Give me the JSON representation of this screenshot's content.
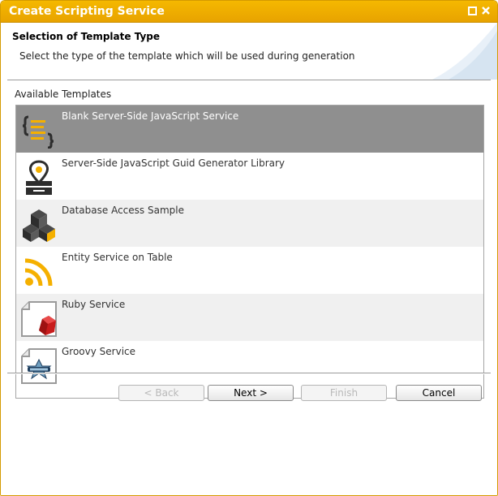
{
  "window": {
    "title": "Create Scripting Service"
  },
  "header": {
    "title": "Selection of Template Type",
    "description": "Select the type of the template which will be used during generation"
  },
  "templates": {
    "label": "Available Templates",
    "items": [
      {
        "label": "Blank Server-Side JavaScript Service",
        "icon": "javascript-code-icon",
        "selected": true
      },
      {
        "label": "Server-Side JavaScript Guid Generator Library",
        "icon": "guid-generator-icon",
        "selected": false
      },
      {
        "label": "Database Access Sample",
        "icon": "database-cubes-icon",
        "selected": false
      },
      {
        "label": "Entity Service on Table",
        "icon": "rss-feed-icon",
        "selected": false
      },
      {
        "label": "Ruby Service",
        "icon": "ruby-gem-icon",
        "selected": false
      },
      {
        "label": "Groovy Service",
        "icon": "groovy-star-icon",
        "selected": false
      }
    ]
  },
  "buttons": {
    "back": "< Back",
    "next": "Next >",
    "finish": "Finish",
    "cancel": "Cancel"
  },
  "colors": {
    "titlebar": "#f0b100",
    "selected_row": "#8f8f8f",
    "accent_yellow": "#f5b000"
  }
}
